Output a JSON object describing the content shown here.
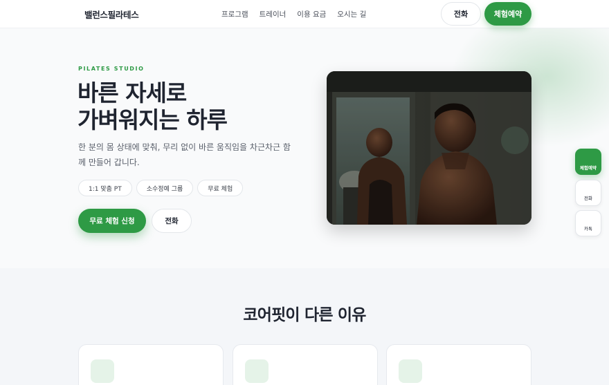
{
  "brand": "밸런스필라테스",
  "nav": [
    "프로그램",
    "트레이너",
    "이용 요금",
    "오시는 길"
  ],
  "header": {
    "call_label": "전화",
    "book_label": "체험예약"
  },
  "hero": {
    "eyebrow": "PILATES STUDIO",
    "title_line1": "바른 자세로",
    "title_line2": "가벼워지는 하루",
    "description": "한 분의 몸 상태에 맞춰, 무리 없이 바른 움직임을 차근차근 함께 만들어 갑니다.",
    "chips": [
      "1:1 맞춤 PT",
      "소수정예 그룹",
      "무료 체험"
    ],
    "primary_cta": "무료 체험 신청",
    "call_cta": "전화"
  },
  "side_buttons": {
    "book": "체험예약",
    "call": "전화",
    "talk": "카톡"
  },
  "why": {
    "title": "코어핏이 다른 이유"
  },
  "colors": {
    "accent": "#2e9a45",
    "accent_soft": "#e5f3e8",
    "section_bg": "#f4f6f9"
  }
}
